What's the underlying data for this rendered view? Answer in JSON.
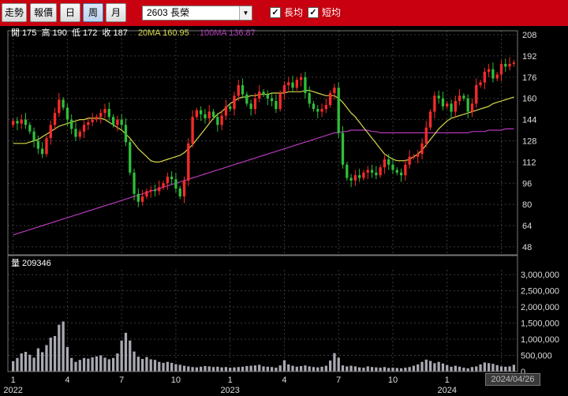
{
  "toolbar": {
    "buttons": [
      {
        "label": "走勢",
        "active": false
      },
      {
        "label": "報價",
        "active": false
      },
      {
        "label": "日",
        "active": false
      },
      {
        "label": "周",
        "active": true
      },
      {
        "label": "月",
        "active": false
      }
    ],
    "stock_select": "2603 長榮",
    "checkbox_long": {
      "label": "長均",
      "checked": true
    },
    "checkbox_short": {
      "label": "短均",
      "checked": true
    }
  },
  "info": {
    "open_label": "開 175",
    "high_label": "高 190",
    "low_label": "低 172",
    "close_label": "收 187",
    "ma20_label": "20MA 160.95",
    "ma100_label": "100MA 136.87",
    "volume_label": "量 209346"
  },
  "date_badge": "2024/04/26",
  "colors": {
    "up": "#ff2a2a",
    "down": "#2fbf3a",
    "ma20": "#d8d84a",
    "ma100": "#b43ab8",
    "volume": "#a9a9b3",
    "grid": "#3a3a3a"
  },
  "chart_data": [
    {
      "type": "candlestick",
      "title": "",
      "y_ticks": [
        48,
        64,
        80,
        96,
        112,
        128,
        144,
        160,
        176,
        192,
        208
      ],
      "ylim": [
        42,
        211
      ],
      "x_tick_labels": [
        "1",
        "4",
        "7",
        "10",
        "1",
        "4",
        "7",
        "10",
        "1",
        "4"
      ],
      "x_tick_index": [
        0,
        13,
        26,
        39,
        52,
        65,
        78,
        91,
        104,
        117
      ],
      "x_year_labels": [
        "2022",
        "2023",
        "2024"
      ],
      "x_year_index": [
        0,
        52,
        104
      ],
      "close": [
        143,
        141,
        144,
        140,
        135,
        128,
        122,
        118,
        130,
        140,
        149,
        159,
        153,
        144,
        137,
        131,
        135,
        140,
        142,
        144,
        146,
        149,
        152,
        146,
        140,
        144,
        140,
        127,
        104,
        88,
        82,
        86,
        90,
        91,
        90,
        93,
        96,
        101,
        99,
        92,
        86,
        98,
        126,
        146,
        151,
        148,
        145,
        150,
        146,
        140,
        147,
        154,
        152,
        162,
        170,
        163,
        156,
        152,
        160,
        165,
        163,
        160,
        158,
        152,
        164,
        170,
        172,
        168,
        174,
        176,
        164,
        156,
        152,
        150,
        152,
        155,
        164,
        168,
        134,
        110,
        100,
        98,
        102,
        100,
        104,
        106,
        104,
        102,
        108,
        114,
        110,
        106,
        104,
        102,
        110,
        116,
        116,
        118,
        126,
        138,
        150,
        162,
        160,
        154,
        156,
        150,
        158,
        162,
        160,
        150,
        156,
        170,
        172,
        180,
        182,
        175,
        178,
        186,
        184,
        186,
        187
      ],
      "ma20": [
        126,
        126,
        126,
        126,
        127,
        128,
        129,
        131,
        133,
        135,
        137,
        139,
        140,
        141,
        142,
        143,
        144,
        144,
        145,
        145,
        145,
        145,
        144,
        142,
        140,
        138,
        136,
        133,
        130,
        126,
        122,
        119,
        116,
        113,
        112,
        112,
        113,
        114,
        115,
        116,
        117,
        119,
        122,
        125,
        129,
        133,
        137,
        141,
        145,
        148,
        150,
        153,
        156,
        158,
        160,
        161,
        161,
        162,
        162,
        163,
        163,
        163,
        164,
        164,
        164,
        164,
        165,
        165,
        165,
        165,
        166,
        166,
        165,
        164,
        163,
        162,
        162,
        162,
        160,
        157,
        153,
        149,
        146,
        142,
        138,
        134,
        130,
        126,
        122,
        118,
        116,
        114,
        113,
        113,
        113,
        114,
        116,
        118,
        121,
        125,
        129,
        133,
        137,
        140,
        143,
        145,
        146,
        147,
        148,
        149,
        150,
        151,
        152,
        153,
        154,
        156,
        157,
        158,
        159,
        160,
        161
      ],
      "ma100": [
        57,
        58,
        59,
        60,
        61,
        62,
        63,
        64,
        65,
        66,
        67,
        68,
        69,
        70,
        71,
        72,
        73,
        74,
        75,
        76,
        77,
        78,
        79,
        80,
        81,
        82,
        83,
        84,
        85,
        86,
        87,
        88,
        89,
        90,
        91,
        92,
        93,
        94,
        95,
        96,
        97,
        98,
        99,
        100,
        101,
        102,
        103,
        104,
        105,
        106,
        107,
        108,
        109,
        110,
        111,
        112,
        113,
        114,
        115,
        116,
        117,
        118,
        119,
        120,
        121,
        122,
        123,
        124,
        125,
        126,
        127,
        128,
        129,
        130,
        131,
        132,
        133,
        134,
        134,
        135,
        135,
        136,
        136,
        136,
        136,
        136,
        135,
        135,
        134,
        134,
        134,
        134,
        134,
        134,
        134,
        134,
        134,
        134,
        134,
        134,
        134,
        134,
        134,
        134,
        134,
        134,
        134,
        134,
        134,
        134,
        135,
        135,
        135,
        135,
        136,
        136,
        136,
        136,
        137,
        137,
        137
      ]
    },
    {
      "type": "bar",
      "title": "",
      "y_ticks": [
        0,
        500000,
        1000000,
        1500000,
        2000000,
        2500000,
        3000000
      ],
      "y_tick_labels": [
        "0",
        "500,000",
        "1,000,000",
        "1,500,000",
        "2,000,000",
        "2,500,000",
        "3,000,000"
      ],
      "ylim": [
        0,
        3150000
      ],
      "values": [
        320000,
        420000,
        560000,
        610000,
        520000,
        430000,
        720000,
        600000,
        820000,
        1050000,
        1100000,
        1450000,
        1550000,
        760000,
        420000,
        300000,
        360000,
        420000,
        400000,
        440000,
        470000,
        500000,
        430000,
        380000,
        420000,
        560000,
        960000,
        1200000,
        960000,
        620000,
        460000,
        390000,
        450000,
        380000,
        360000,
        300000,
        270000,
        300000,
        270000,
        230000,
        210000,
        180000,
        160000,
        140000,
        130000,
        150000,
        170000,
        160000,
        140000,
        150000,
        130000,
        140000,
        120000,
        130000,
        140000,
        150000,
        170000,
        180000,
        190000,
        210000,
        160000,
        150000,
        140000,
        120000,
        190000,
        350000,
        220000,
        180000,
        150000,
        170000,
        190000,
        160000,
        140000,
        130000,
        150000,
        180000,
        340000,
        570000,
        430000,
        190000,
        160000,
        180000,
        160000,
        130000,
        120000,
        160000,
        140000,
        130000,
        120000,
        140000,
        110000,
        120000,
        110000,
        100000,
        120000,
        140000,
        180000,
        220000,
        300000,
        370000,
        330000,
        260000,
        300000,
        250000,
        200000,
        150000,
        180000,
        150000,
        120000,
        100000,
        140000,
        160000,
        220000,
        280000,
        260000,
        240000,
        200000,
        160000,
        150000,
        160000,
        209346
      ]
    }
  ]
}
